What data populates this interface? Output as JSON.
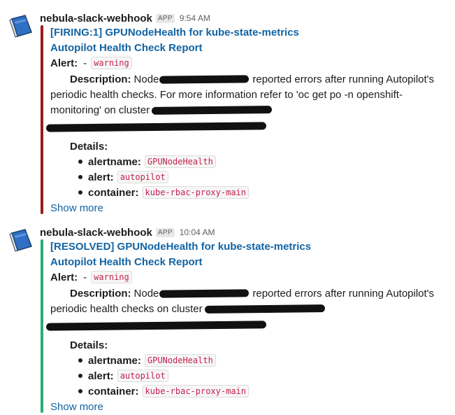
{
  "messages": [
    {
      "sender": "nebula-slack-webhook",
      "badge": "APP",
      "time": "9:54 AM",
      "bar_color": "#9b1b1b",
      "title": "[FIRING:1] GPUNodeHealth for kube-state-metrics",
      "report_title": "Autopilot Health Check Report",
      "alert_label": "Alert:",
      "alert_dash": "-",
      "alert_value": "warning",
      "description_label": "Description:",
      "desc_line1_a": "Node",
      "desc_line1_b": "reported errors after running Autopilot's",
      "desc_line2": "periodic health checks. For more information refer to 'oc get po -n openshift-",
      "desc_line3": "monitoring' on cluster",
      "details_label": "Details:",
      "details": [
        {
          "key": "alertname:",
          "value": "GPUNodeHealth"
        },
        {
          "key": "alert:",
          "value": "autopilot"
        },
        {
          "key": "container:",
          "value": "kube-rbac-proxy-main"
        }
      ],
      "show_more": "Show more"
    },
    {
      "sender": "nebula-slack-webhook",
      "badge": "APP",
      "time": "10:04 AM",
      "bar_color": "#2bac76",
      "title": "[RESOLVED] GPUNodeHealth for kube-state-metrics",
      "report_title": "Autopilot Health Check Report",
      "alert_label": "Alert:",
      "alert_dash": "-",
      "alert_value": "warning",
      "description_label": "Description:",
      "desc_line1_a": "Node",
      "desc_line1_b": "reported errors after running Autopilot's",
      "desc_line2": "periodic health checks  on cluster",
      "details_label": "Details:",
      "details": [
        {
          "key": "alertname:",
          "value": "GPUNodeHealth"
        },
        {
          "key": "alert:",
          "value": "autopilot"
        },
        {
          "key": "container:",
          "value": "kube-rbac-proxy-main"
        }
      ],
      "show_more": "Show more"
    }
  ]
}
